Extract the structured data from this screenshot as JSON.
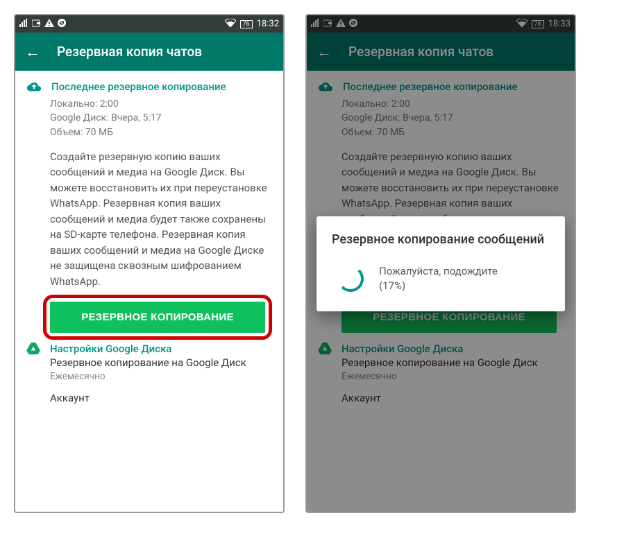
{
  "status": {
    "time1": "18:32",
    "time2": "18:33",
    "battery": "76"
  },
  "appbar": {
    "title": "Резервная копия чатов"
  },
  "section1": {
    "title": "Последнее резервное копирование",
    "line1": "Локально: 2:00",
    "line2": "Google Диск: Вчера, 5:17",
    "line3": "Объем: 70 МБ"
  },
  "body": "Создайте резервную копию ваших сообщений и медиа на Google Диск. Вы можете восстановить их при переустановке WhatsApp. Резервная копия ваших сообщений и медиа будет также сохранены на SD-карте телефона. Резервная копия ваших сообщений и медиа на Google Диске не защищена сквозным шифрованием WhatsApp.",
  "button": {
    "label": "РЕЗЕРВНОЕ КОПИРОВАНИЕ"
  },
  "gd": {
    "title": "Настройки Google Диска",
    "line1": "Резервное копирование на Google Диск",
    "line2": "Ежемесячно",
    "line3": "Аккаунт"
  },
  "dialog": {
    "title": "Резервное копирование сообщений",
    "msg1": "Пожалуйста, подождите",
    "msg2": "(17%)"
  }
}
